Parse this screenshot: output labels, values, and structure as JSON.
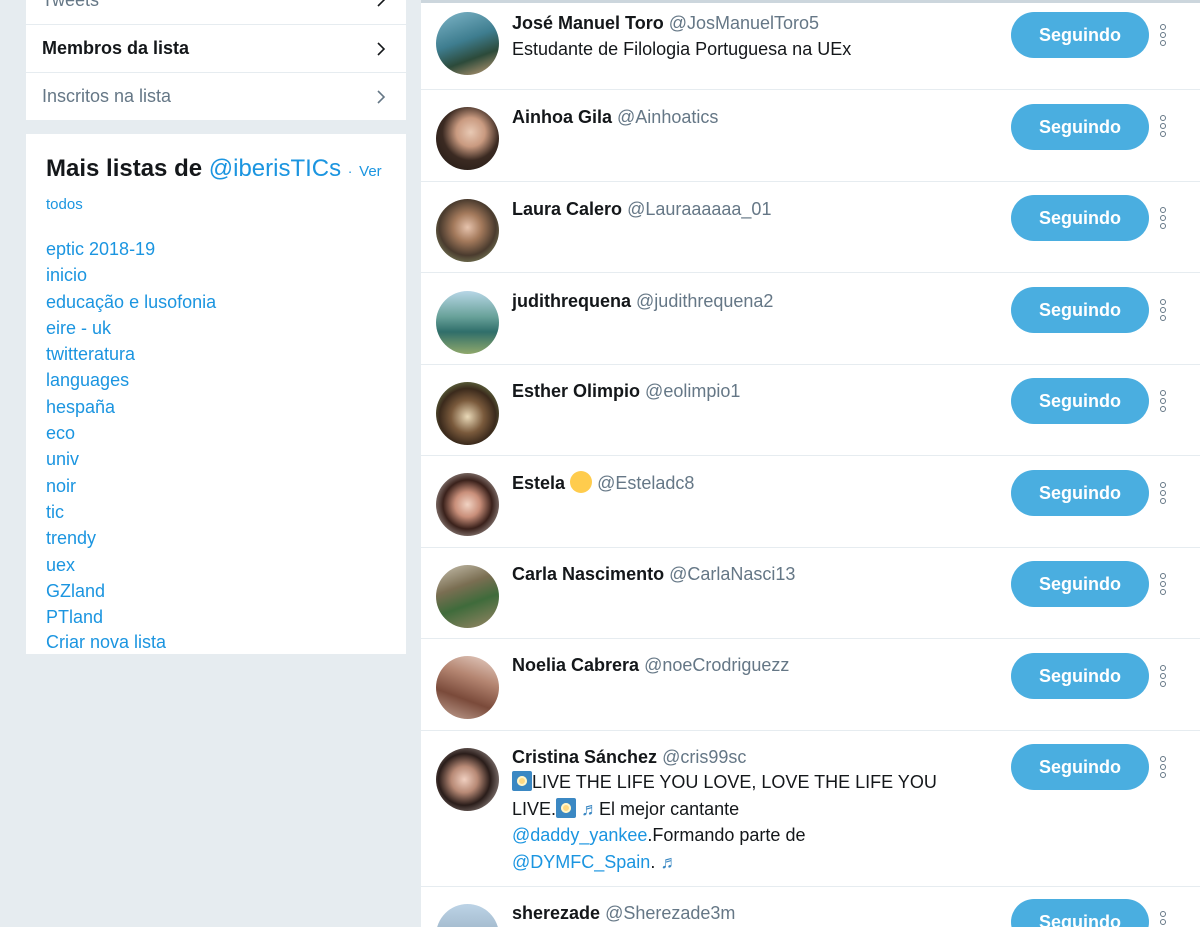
{
  "nav": {
    "tweets_label": "Tweets",
    "members_label": "Membros da lista",
    "subscribers_label": "Inscritos na lista"
  },
  "more_lists": {
    "title": "Mais listas de",
    "owner": "@iberisTICs",
    "separator": "·",
    "see_all": "Ver todos",
    "items": [
      "eptic 2018-19",
      "inicio",
      "educação e lusofonia",
      "eire - uk",
      "twitteratura",
      "languages",
      "hespaña",
      "eco",
      "univ",
      "noir",
      "tic",
      "trendy",
      "uex",
      "GZland",
      "PTland"
    ],
    "create_label": "Criar nova lista"
  },
  "members": [
    {
      "name": "José Manuel Toro",
      "handle": "@JosManuelToro5",
      "bio": "Estudante de Filologia Portuguesa na UEx",
      "button": "Seguindo"
    },
    {
      "name": "Ainhoa Gila",
      "handle": "@Ainhoatics",
      "button": "Seguindo"
    },
    {
      "name": "Laura Calero",
      "handle": "@Lauraaaaaa_01",
      "button": "Seguindo"
    },
    {
      "name": "judithrequena",
      "handle": "@judithrequena2",
      "button": "Seguindo"
    },
    {
      "name": "Esther Olimpio",
      "handle": "@eolimpio1",
      "button": "Seguindo"
    },
    {
      "name": "Estela",
      "handle": "@Esteladc8",
      "button": "Seguindo"
    },
    {
      "name": "Carla Nascimento",
      "handle": "@CarlaNasci13",
      "button": "Seguindo"
    },
    {
      "name": "Noelia Cabrera",
      "handle": "@noeCrodriguezz",
      "button": "Seguindo"
    },
    {
      "name": "Cristina Sánchez",
      "handle": "@cris99sc",
      "button": "Seguindo",
      "bio_parts": {
        "line1": "LIVE THE LIFE YOU LOVE, LOVE THE LIFE YOU",
        "line2a": "LIVE.",
        "line2b": "El mejor cantante",
        "mention1": "@daddy_yankee",
        "line3b": ".Formando parte de",
        "mention2": "@DYMFC_Spain",
        "line4b": "."
      }
    },
    {
      "name": "sherezade",
      "handle": "@Sherezade3m",
      "button": "Seguindo"
    }
  ],
  "colors": {
    "accent": "#1b95e0",
    "button_bg": "#4aaee0",
    "background": "#e6ecf0",
    "muted_text": "#657786"
  },
  "icons": {
    "chevron": "chevron-right-icon",
    "more": "more-vertical-icon"
  }
}
